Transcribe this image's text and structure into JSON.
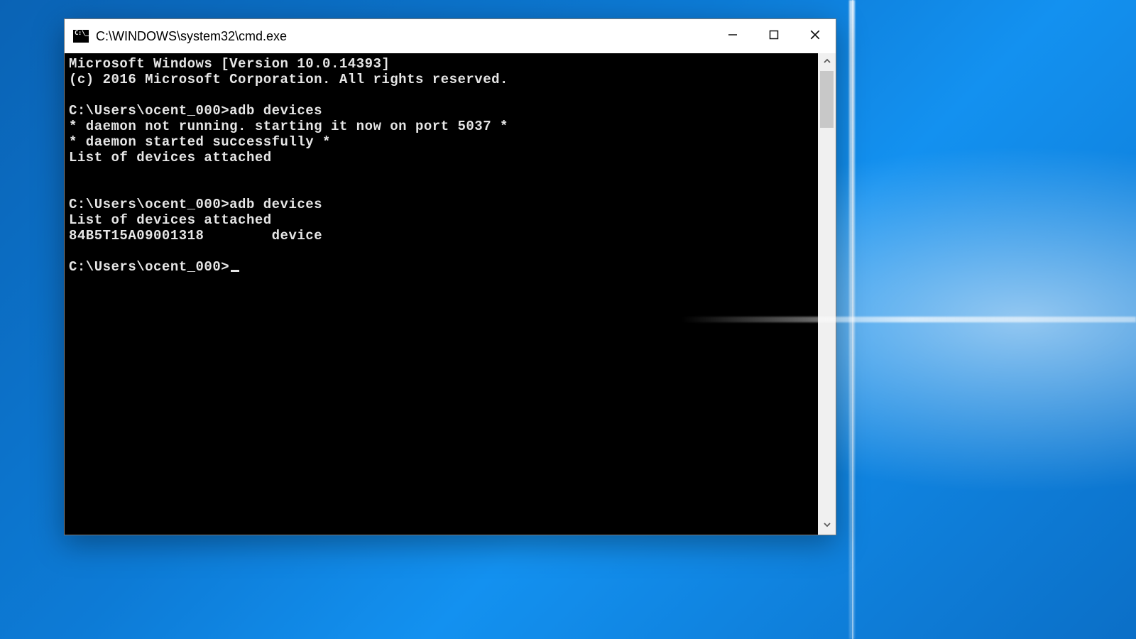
{
  "window": {
    "title": "C:\\WINDOWS\\system32\\cmd.exe"
  },
  "terminal": {
    "lines": [
      "Microsoft Windows [Version 10.0.14393]",
      "(c) 2016 Microsoft Corporation. All rights reserved.",
      "",
      "C:\\Users\\ocent_000>adb devices",
      "* daemon not running. starting it now on port 5037 *",
      "* daemon started successfully *",
      "List of devices attached",
      "",
      "",
      "C:\\Users\\ocent_000>adb devices",
      "List of devices attached",
      "84B5T15A09001318        device",
      "",
      ""
    ],
    "prompt": "C:\\Users\\ocent_000>"
  }
}
